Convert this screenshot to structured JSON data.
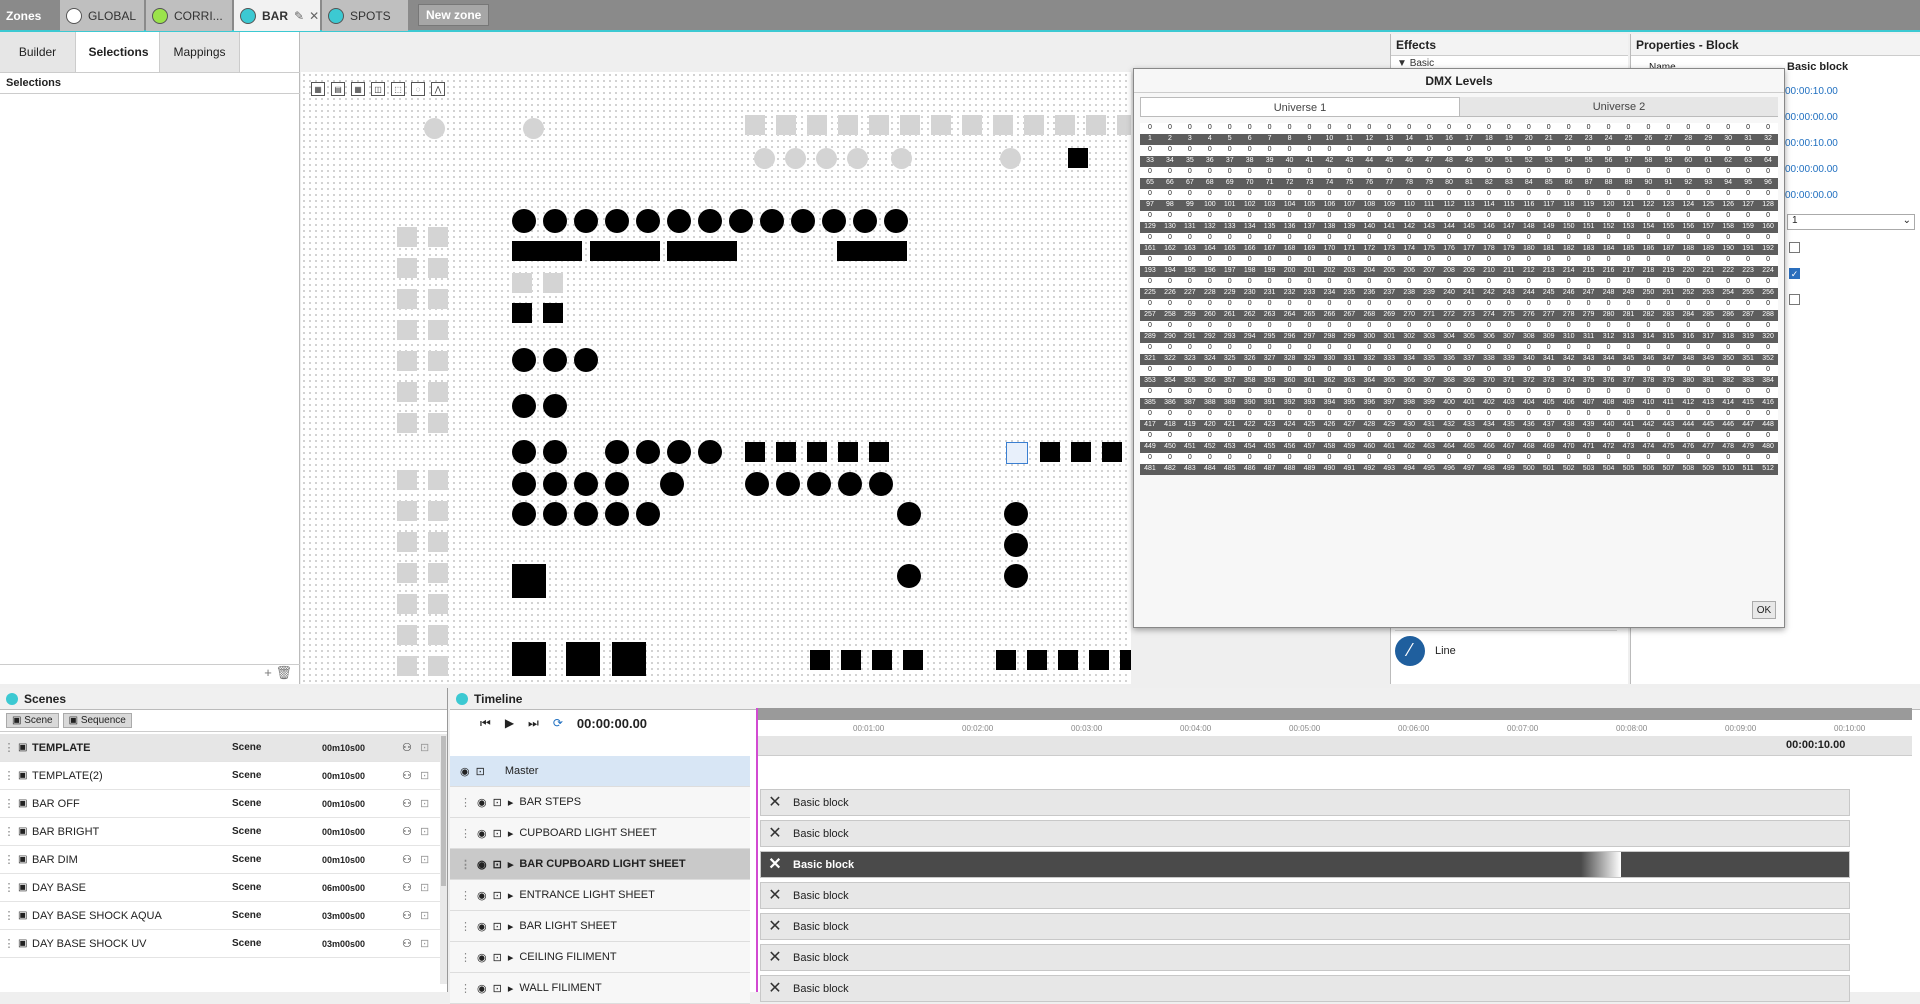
{
  "zones": {
    "label": "Zones",
    "tabs": [
      {
        "name": "GLOBAL",
        "color": "#ffffff"
      },
      {
        "name": "CORRI...",
        "color": "#9be34b"
      },
      {
        "name": "BAR",
        "color": "#3cc9d2"
      },
      {
        "name": "SPOTS",
        "color": "#3cc9d2"
      }
    ],
    "new_zone": "New zone"
  },
  "left_tabs": [
    "Builder",
    "Selections",
    "Mappings"
  ],
  "selections_title": "Selections",
  "effects": {
    "title": "Effects",
    "group": "Basic",
    "line_label": "Line"
  },
  "properties": {
    "title": "Properties - Block",
    "name_label": "Name",
    "name_value": "Basic block",
    "times": [
      "00:00:10.00",
      "00:00:00.00",
      "00:00:10.00",
      "00:00:00.00",
      "00:00:00.00"
    ],
    "select_value": "1"
  },
  "dmx": {
    "title": "DMX Levels",
    "universes": [
      "Universe 1",
      "Universe 2"
    ],
    "ok": "OK"
  },
  "scenes": {
    "title": "Scenes",
    "buttons": [
      "Scene",
      "Sequence"
    ],
    "rows": [
      {
        "name": "TEMPLATE",
        "type": "Scene",
        "time": "00m10s00"
      },
      {
        "name": "TEMPLATE(2)",
        "type": "Scene",
        "time": "00m10s00"
      },
      {
        "name": "BAR OFF",
        "type": "Scene",
        "time": "00m10s00"
      },
      {
        "name": "BAR BRIGHT",
        "type": "Scene",
        "time": "00m10s00"
      },
      {
        "name": "BAR DIM",
        "type": "Scene",
        "time": "00m10s00"
      },
      {
        "name": "DAY BASE",
        "type": "Scene",
        "time": "06m00s00"
      },
      {
        "name": "DAY BASE SHOCK AQUA",
        "type": "Scene",
        "time": "03m00s00"
      },
      {
        "name": "DAY BASE SHOCK UV",
        "type": "Scene",
        "time": "03m00s00"
      }
    ]
  },
  "timeline": {
    "title": "Timeline",
    "time": "00:00:00.00",
    "end_time": "00:00:10.00",
    "ruler": [
      "00:01:00",
      "00:02:00",
      "00:03:00",
      "00:04:00",
      "00:05:00",
      "00:06:00",
      "00:07:00",
      "00:08:00",
      "00:09:00",
      "00:10:00"
    ],
    "master": "Master",
    "tracks": [
      "BAR STEPS",
      "CUPBOARD LIGHT SHEET",
      "BAR CUPBOARD LIGHT SHEET",
      "ENTRANCE LIGHT SHEET",
      "BAR LIGHT SHEET",
      "CEILING FILIMENT",
      "WALL FILIMENT"
    ],
    "block_label": "Basic block"
  }
}
